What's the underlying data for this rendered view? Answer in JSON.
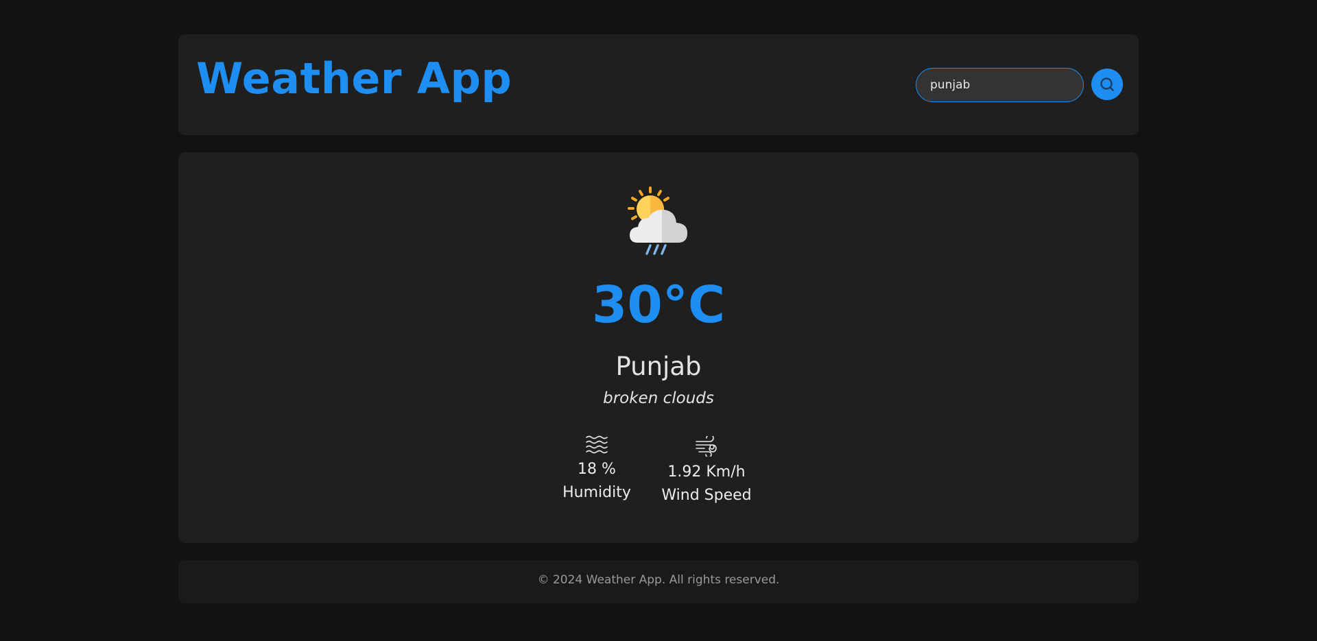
{
  "header": {
    "title": "Weather App",
    "search": {
      "value": "punjab",
      "placeholder": "Enter city name",
      "button_icon": "search-icon"
    }
  },
  "weather": {
    "icon": "sun-cloud-rain-icon",
    "temperature": "30°C",
    "city": "Punjab",
    "description": "broken clouds",
    "humidity": {
      "icon": "humidity-waves-icon",
      "value": "18 %",
      "label": "Humidity"
    },
    "wind": {
      "icon": "wind-icon",
      "value": "1.92 Km/h",
      "label": "Wind Speed"
    }
  },
  "footer": {
    "text": "© 2024 Weather App. All rights reserved."
  },
  "colors": {
    "accent": "#1e8ef2",
    "background": "#121212",
    "card": "#1f1f1f"
  }
}
